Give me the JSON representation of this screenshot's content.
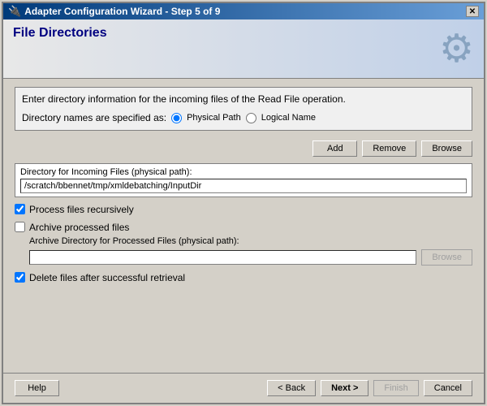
{
  "window": {
    "title": "Adapter Configuration Wizard - Step 5 of 9",
    "close_label": "✕"
  },
  "header": {
    "title": "File Directories",
    "icon": "⚙"
  },
  "info": {
    "text": "Enter directory information for the incoming files of the Read File operation.",
    "radio_label": "Directory names are specified as:",
    "radio_physical": "Physical Path",
    "radio_logical": "Logical Name"
  },
  "buttons": {
    "add": "Add",
    "remove": "Remove",
    "browse": "Browse"
  },
  "incoming_dir": {
    "label": "Directory for Incoming Files (physical path):",
    "value": "/scratch/bbennet/tmp/xmldebatching/InputDir"
  },
  "checkboxes": {
    "process_recursive": "Process files recursively",
    "archive_files": "Archive processed files",
    "delete_files": "Delete files after successful retrieval"
  },
  "archive": {
    "label": "Archive Directory for Processed Files (physical path):",
    "value": "",
    "browse": "Browse"
  },
  "footer": {
    "help": "Help",
    "back": "< Back",
    "next": "Next >",
    "finish": "Finish",
    "cancel": "Cancel"
  }
}
